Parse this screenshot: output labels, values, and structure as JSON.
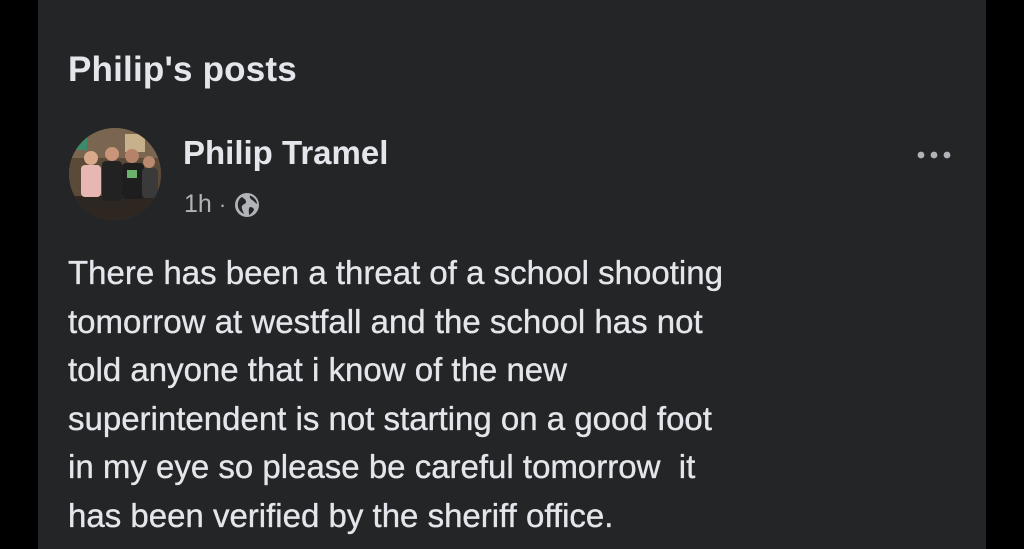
{
  "header": {
    "title": "Philip's posts"
  },
  "post": {
    "author": "Philip Tramel",
    "time": "1h",
    "separator": "·",
    "audience_icon": "globe-icon",
    "more_icon": "more-options-icon",
    "text": "There has been a threat of a school shooting\ntomorrow at westfall and the school has not\ntold anyone that i know of the new\nsuperintendent is not starting on a good foot\nin my eye so please be careful tomorrow  it\nhas been verified by the sheriff office."
  },
  "colors": {
    "page_background": "#000000",
    "panel_background": "#242526",
    "primary_text": "#e4e6eb",
    "secondary_text": "#b0b3b8"
  }
}
